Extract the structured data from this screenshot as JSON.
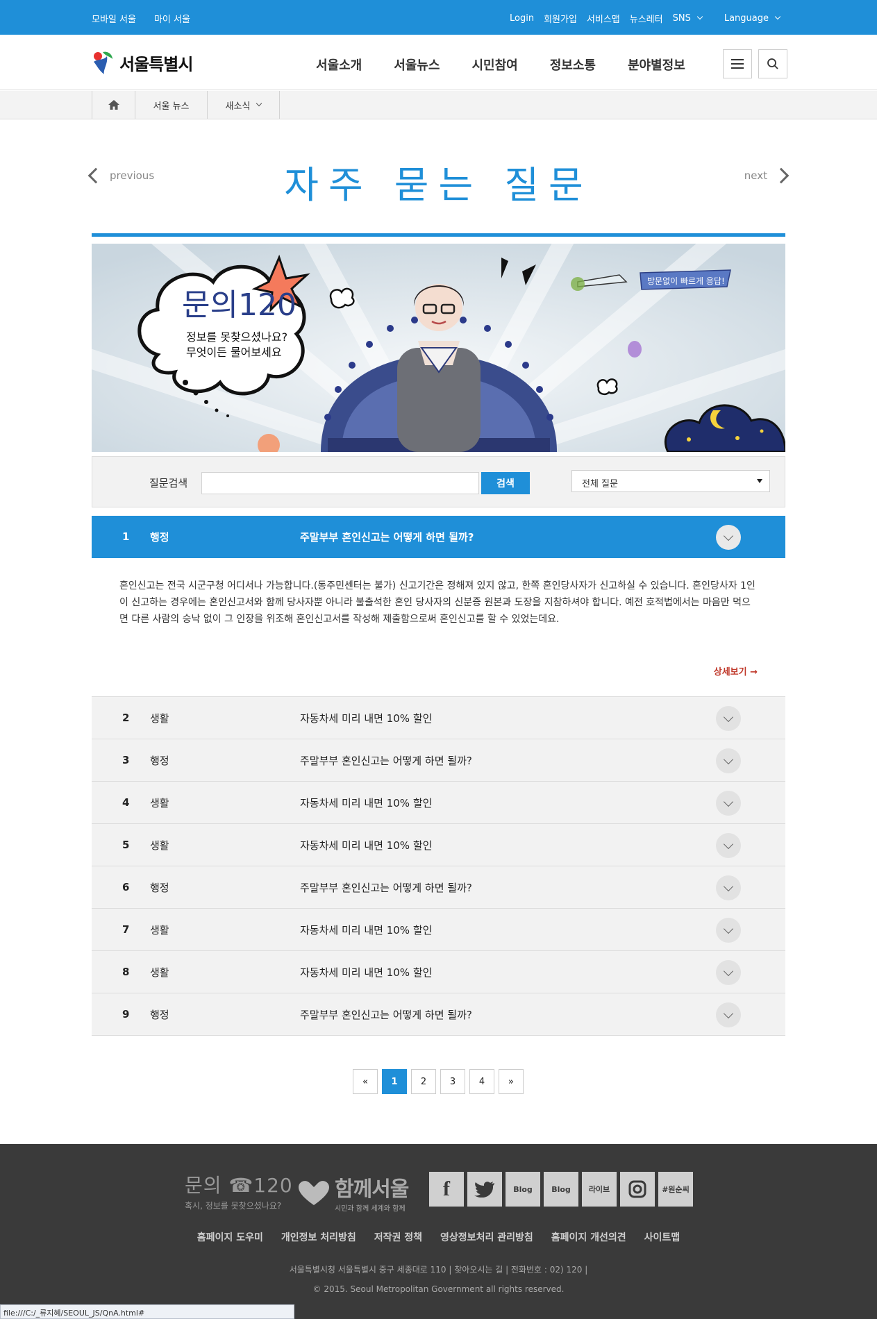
{
  "topbar": {
    "left_links": [
      "모바일 서울",
      "마이 서울"
    ],
    "right_links": [
      "Login",
      "회원가입",
      "서비스맵",
      "뉴스레터"
    ],
    "sns_label": "SNS",
    "language_label": "Language"
  },
  "header": {
    "logo_text": "서울특별시",
    "nav": [
      "서울소개",
      "서울뉴스",
      "시민참여",
      "정보소통",
      "분야별정보"
    ]
  },
  "breadcrumb": {
    "level1": "서울 뉴스",
    "level2": "새소식"
  },
  "title_area": {
    "previous": "previous",
    "title": "자주 묻는 질문",
    "next": "next"
  },
  "banner": {
    "headline": "문의120",
    "line1": "정보를 못찾으셨나요?",
    "line2": "무엇이든 물어보세요",
    "ribbon": "방문없이 빠르게 응답!"
  },
  "search": {
    "label": "질문검색",
    "input_value": "",
    "button": "검색",
    "select_value": "전체 질문"
  },
  "faq": {
    "open": {
      "num": "1",
      "cat": "행정",
      "q": "주말부부 혼인신고는 어떻게 하면 될까?",
      "answer": "혼인신고는 전국 시군구청 어디서나 가능합니다.(동주민센터는 불가) 신고기간은 정해져 있지 않고, 한쪽 혼인당사자가 신고하실 수 있습니다. 혼인당사자 1인이 신고하는 경우에는 혼인신고서와 함께 당사자뿐 아니라 불출석한 혼인 당사자의 신분증 원본과 도장을 지참하셔야 합니다. 예전 호적법에서는 마음만 먹으면 다른 사람의 승낙 없이 그 인장을 위조해 혼인신고서를 작성해 제출함으로써 혼인신고를 할 수 있었는데요.",
      "more": "상세보기 →"
    },
    "rows": [
      {
        "num": "2",
        "cat": "생활",
        "q": "자동차세 미리 내면 10% 할인"
      },
      {
        "num": "3",
        "cat": "행정",
        "q": "주말부부 혼인신고는 어떻게 하면 될까?"
      },
      {
        "num": "4",
        "cat": "생활",
        "q": "자동차세 미리 내면 10% 할인"
      },
      {
        "num": "5",
        "cat": "생활",
        "q": "자동차세 미리 내면 10% 할인"
      },
      {
        "num": "6",
        "cat": "행정",
        "q": "주말부부 혼인신고는 어떻게 하면 될까?"
      },
      {
        "num": "7",
        "cat": "생활",
        "q": "자동차세 미리 내면 10% 할인"
      },
      {
        "num": "8",
        "cat": "생활",
        "q": "자동차세 미리 내면 10% 할인"
      },
      {
        "num": "9",
        "cat": "행정",
        "q": "주말부부 혼인신고는 어떻게 하면 될까?"
      }
    ]
  },
  "pagination": {
    "first": "«",
    "pages": [
      "1",
      "2",
      "3",
      "4"
    ],
    "current": "1",
    "last": "»"
  },
  "footer": {
    "inquiry_big": "문의 ☎120",
    "inquiry_small": "혹시, 정보를 못찾으셨나요?",
    "together": "함께서울",
    "together_sub": "시민과 함께 세계와 함께",
    "sns": [
      "f",
      "twitter",
      "Blog",
      "Blog",
      "라이브",
      "instagram",
      "#원순씨"
    ],
    "links": [
      "홈페이지 도우미",
      "개인정보 처리방침",
      "저작권 정책",
      "영상정보처리 관리방침",
      "홈페이지 개선의견",
      "사이트맵"
    ],
    "address": "서울특별시청 서울특별시 중구 세종대로 110  |  찾아오시는 길  |  전화번호 : 02) 120  |",
    "copyright": "© 2015. Seoul Metropolitan Government all rights reserved."
  },
  "statusbar": "file:///C:/_류지혜/SEOUL_JS/QnA.html#",
  "colors": {
    "brand_blue": "#1f8fd8",
    "footer_bg": "#3a3a3a",
    "more_link": "#c0392b"
  }
}
